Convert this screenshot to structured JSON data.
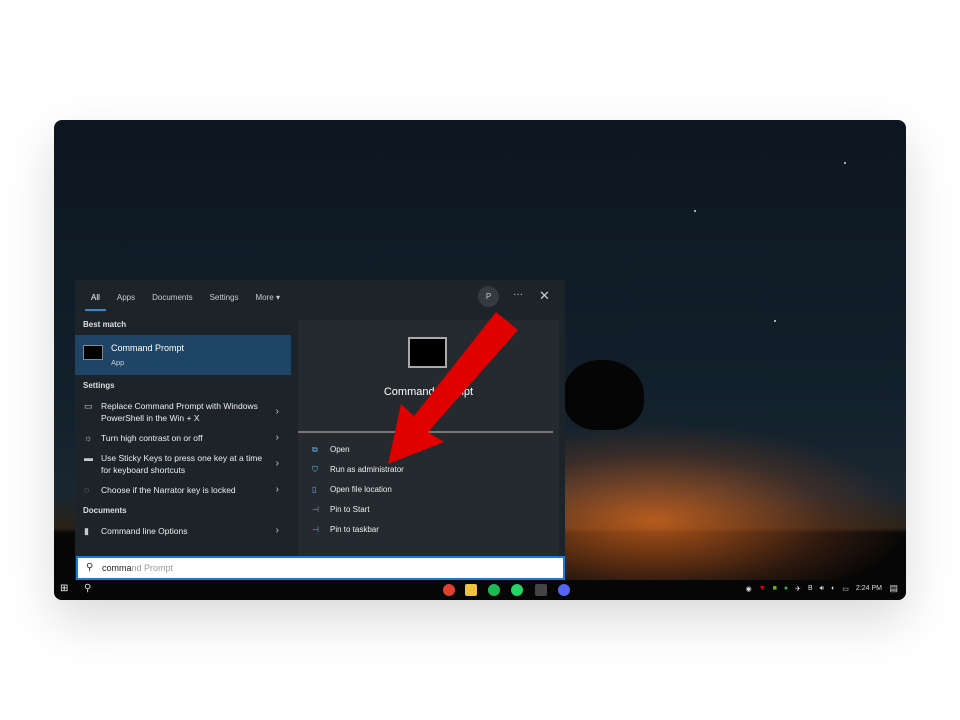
{
  "tabs": [
    "All",
    "Apps",
    "Documents",
    "Settings",
    "More ▾"
  ],
  "avatar": "P",
  "more_icon": "···",
  "close_icon": "✕",
  "best_match": {
    "heading": "Best match",
    "title": "Command Prompt",
    "type": "App"
  },
  "settings": {
    "heading": "Settings",
    "items": [
      "Replace Command Prompt with Windows PowerShell in the Win + X",
      "Turn high contrast on or off",
      "Use Sticky Keys to press one key at a time for keyboard shortcuts",
      "Choose if the Narrator key is locked"
    ]
  },
  "documents": {
    "heading": "Documents",
    "items": [
      "Command line Options"
    ]
  },
  "detail": {
    "title": "Command Prompt",
    "type": "App",
    "actions": [
      "Open",
      "Run as administrator",
      "Open file location",
      "Pin to Start",
      "Pin to taskbar"
    ]
  },
  "search": {
    "typed": "comma",
    "suggestion": "nd Prompt"
  },
  "taskbar": {
    "clock": "2:24 PM"
  },
  "colors": {
    "accent": "#1a7ad8",
    "arrow": "#e00000"
  }
}
